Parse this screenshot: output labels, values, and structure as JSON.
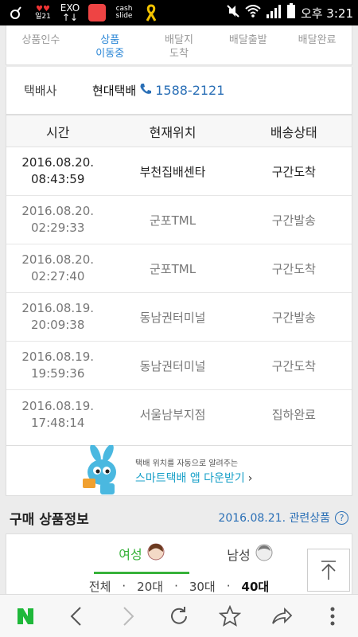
{
  "status_bar": {
    "left_labels": [
      "일21",
      "↑↓",
      "cash slide"
    ],
    "time": "오후 3:21",
    "colors": {
      "bg": "#000000",
      "fg": "#ffffff"
    }
  },
  "progress": {
    "steps": [
      {
        "label": "상품인수",
        "active": false
      },
      {
        "label": "상품\n이동중",
        "active": true
      },
      {
        "label": "배달지\n도착",
        "active": false
      },
      {
        "label": "배달출발",
        "active": false
      },
      {
        "label": "배달완료",
        "active": false
      }
    ]
  },
  "carrier": {
    "label": "택배사",
    "name": "현대택배",
    "phone": "1588-2121"
  },
  "tracking_table": {
    "headers": {
      "time": "시간",
      "location": "현재위치",
      "status": "배송상태"
    },
    "rows": [
      {
        "date": "2016.08.20.",
        "clock": "08:43:59",
        "location": "부천집배센타",
        "status": "구간도착"
      },
      {
        "date": "2016.08.20.",
        "clock": "02:29:33",
        "location": "군포TML",
        "status": "구간발송"
      },
      {
        "date": "2016.08.20.",
        "clock": "02:27:40",
        "location": "군포TML",
        "status": "구간도착"
      },
      {
        "date": "2016.08.19.",
        "clock": "20:09:38",
        "location": "동남권터미널",
        "status": "구간발송"
      },
      {
        "date": "2016.08.19.",
        "clock": "19:59:36",
        "location": "동남권터미널",
        "status": "구간도착"
      },
      {
        "date": "2016.08.19.",
        "clock": "17:48:14",
        "location": "서울남부지점",
        "status": "집하완료"
      }
    ]
  },
  "banner": {
    "small_text": "택배 위치를 자동으로 알려주는",
    "big_text": "스마트택배 앱 다운받기"
  },
  "product_info": {
    "title": "구매 상품정보",
    "date_link": "2016.08.21. 관련상품"
  },
  "gender_tabs": {
    "female": "여성",
    "male": "남성",
    "ages": [
      "전체",
      "20대",
      "30대",
      "40대"
    ],
    "selected_age": "40대"
  },
  "accent_colors": {
    "blue": "#2a86d6",
    "green": "#37b23a",
    "banner_cyan": "#18a0c8"
  }
}
